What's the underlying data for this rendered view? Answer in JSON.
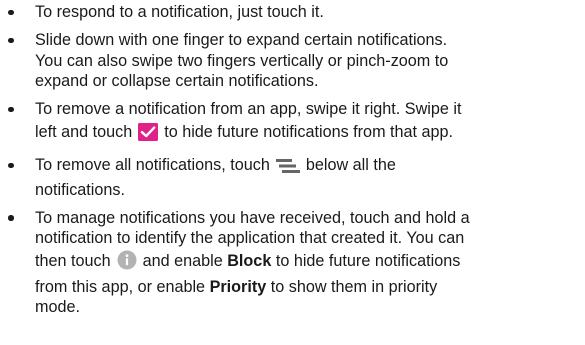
{
  "bullets": [
    {
      "lines": [
        "To respond to a notification, just touch it."
      ]
    },
    {
      "lines": [
        "Slide down with one finger to expand certain notifications.",
        "You can also swipe two fingers vertically or pinch-zoom to",
        "expand or collapse certain notifications."
      ]
    },
    {
      "line1": "To remove a notification from an app, swipe it right. Swipe it",
      "line2_before": "left and touch",
      "line2_after": "to hide future notifications from that app.",
      "icon": "checkmark-box-icon",
      "icon_color": "#e0218a"
    },
    {
      "line1_before": "To remove all notifications, touch",
      "line1_after": "below all the",
      "line2": "notifications.",
      "icon": "clear-all-icon",
      "icon_color": "#666666"
    },
    {
      "line1": "To manage notifications you have received, touch and hold a",
      "line2": "notification to identify the application that created it. You can",
      "line3_before": "then touch",
      "line3_after": "and enable",
      "bold_block": "Block",
      "line3_end": "to hide future notifications",
      "line4_before": "from this app, or enable",
      "bold_priority": "Priority",
      "line4_after": "to show them in priority",
      "line5": "mode.",
      "icon": "info-circle-icon",
      "icon_color": "#b3b3b3"
    }
  ]
}
